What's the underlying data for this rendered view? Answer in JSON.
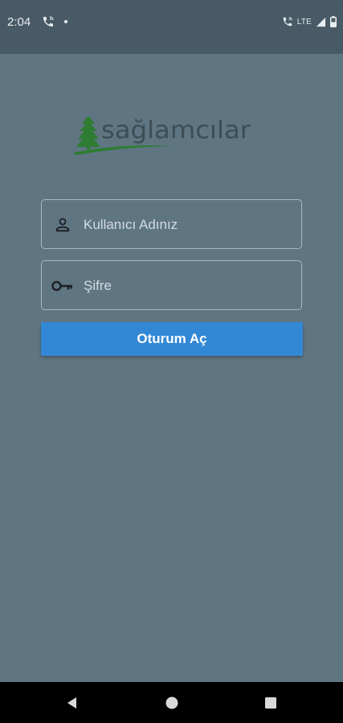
{
  "status_bar": {
    "time": "2:04",
    "network": "LTE",
    "icons": [
      "call-icon",
      "notification-dot-icon",
      "call-icon",
      "signal-icon",
      "battery-icon"
    ]
  },
  "logo": {
    "text": "sağlamcılar",
    "text_color": "#3d4d55",
    "tree_color": "#2e7d32"
  },
  "login": {
    "username_placeholder": "Kullanıcı Adınız",
    "password_placeholder": "Şifre",
    "submit_label": "Oturum Aç",
    "username_icon": "person-icon",
    "password_icon": "key-icon"
  },
  "nav_bar": {
    "icons": [
      "back-icon",
      "home-icon",
      "recents-icon"
    ]
  },
  "colors": {
    "background": "#5f7582",
    "status_bar": "#485a65",
    "button": "#3388d6",
    "field_border": "#aab8c0",
    "nav_bar": "#000000"
  }
}
